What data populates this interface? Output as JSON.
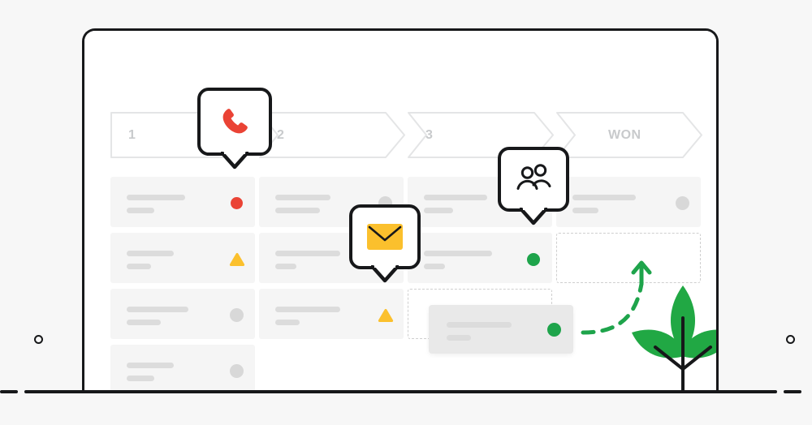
{
  "scene": {
    "title": "CRM sales pipeline drag-and-drop illustration",
    "background_color": "#f7f7f7"
  },
  "device": {
    "name": "laptop",
    "frame_color": "#17181a",
    "screen_color": "#ffffff",
    "notch_label": "",
    "camera_label": ""
  },
  "pipeline": {
    "stages": [
      {
        "label": "1",
        "shape": "rect-arrow"
      },
      {
        "label": "2",
        "shape": "chevron"
      },
      {
        "label": "3",
        "shape": "chevron"
      },
      {
        "label": "WON",
        "shape": "chevron"
      }
    ],
    "stage_text_color": "#c8cacc",
    "stage_border_color": "#e4e5e6"
  },
  "columns": [
    {
      "stage": "1",
      "cards": [
        {
          "status": "red",
          "status_shape": "circle",
          "status_color": "#ea4335"
        },
        {
          "status": "warn",
          "status_shape": "triangle",
          "status_color": "#fbc02d"
        },
        {
          "status": "idle",
          "status_shape": "circle",
          "status_color": "#d8d8d8"
        },
        {
          "status": "idle",
          "status_shape": "circle",
          "status_color": "#d8d8d8"
        }
      ]
    },
    {
      "stage": "2",
      "cards": [
        {
          "status": "idle",
          "status_shape": "circle",
          "status_color": "#d8d8d8"
        },
        {
          "status": "idle",
          "status_shape": "circle",
          "status_color": "#d8d8d8"
        },
        {
          "status": "warn",
          "status_shape": "triangle",
          "status_color": "#fbc02d"
        }
      ]
    },
    {
      "stage": "3",
      "cards": [
        {
          "status": "idle",
          "status_shape": "circle",
          "status_color": "#d8d8d8"
        },
        {
          "status": "green",
          "status_shape": "circle",
          "status_color": "#1ea44b"
        }
      ],
      "empty_slot": true
    },
    {
      "stage": "WON",
      "cards": [
        {
          "status": "idle",
          "status_shape": "circle",
          "status_color": "#d8d8d8"
        }
      ],
      "drop_target": true
    }
  ],
  "drag": {
    "card_status": "green",
    "card_status_color": "#1ea44b",
    "arrow_color": "#1ea44b",
    "arrow_style": "dashed-curve-up",
    "source_slot": "stage-3-slot",
    "target_slot": "won-drop-zone"
  },
  "callouts": [
    {
      "icon": "phone-icon",
      "icon_color": "#ea4335",
      "anchor": "stage-1-card-1"
    },
    {
      "icon": "email-icon",
      "icon_color": "#fbc02d",
      "anchor": "stage-2-card-3"
    },
    {
      "icon": "people-icon",
      "icon_color": "#17181a",
      "anchor": "stage-3-card-2"
    }
  ],
  "plant": {
    "leaf_color": "#21a844",
    "stem_color": "#17181a",
    "leaf_count": 3
  }
}
